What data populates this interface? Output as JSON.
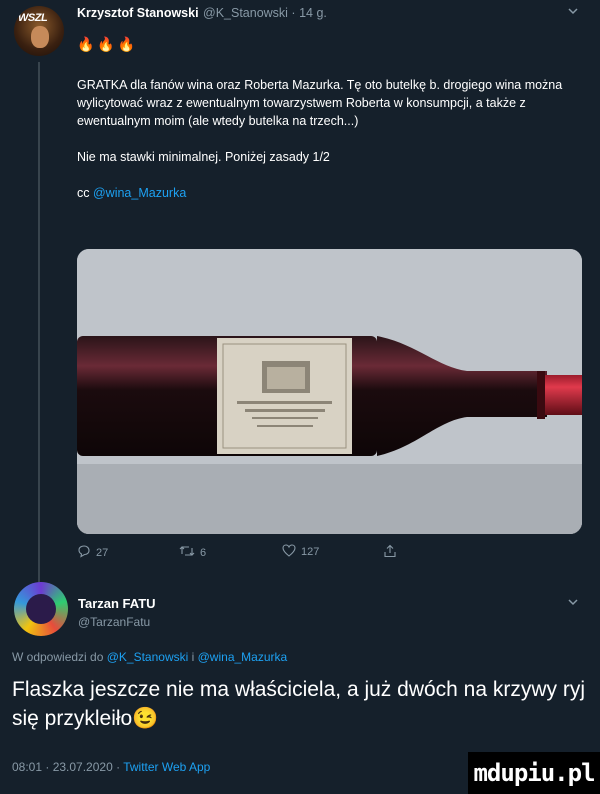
{
  "tweet1": {
    "avatar_text": "WSZL",
    "name": "Krzysztof Stanowski",
    "handle": "@K_Stanowski",
    "time": "14 g.",
    "emojis": "🔥🔥🔥",
    "paragraphs": [
      "GRATKA dla fanów wina oraz Roberta Mazurka. Tę oto butelkę b. drogiego wina można wylicytować wraz z ewentualnym towarzystwem Roberta w konsumpcji, a także z ewentualnym moim (ale wtedy butelka na trzech...)",
      "Nie ma stawki minimalnej. Poniżej zasady 1/2"
    ],
    "cc_prefix": "cc ",
    "cc_mention": "@wina_Mazurka",
    "actions": {
      "replies": "27",
      "retweets": "6",
      "likes": "127"
    }
  },
  "tweet2": {
    "name": "Tarzan FATU",
    "handle": "@TarzanFatu",
    "reply_prefix": "W odpowiedzi do ",
    "reply_mention1": "@K_Stanowski",
    "reply_and": " i ",
    "reply_mention2": "@wina_Mazurka",
    "text": "Flaszka jeszcze nie ma właściciela, a już dwóch na krzywy ryj się przykleiło",
    "emoji": "😉",
    "timestamp": "08:01 · 23.07.2020 · ",
    "source": "Twitter Web App"
  },
  "watermark": "mdupiu.pl",
  "colors": {
    "background": "#15202b",
    "secondary_text": "#8899a6",
    "link": "#1da1f2"
  }
}
